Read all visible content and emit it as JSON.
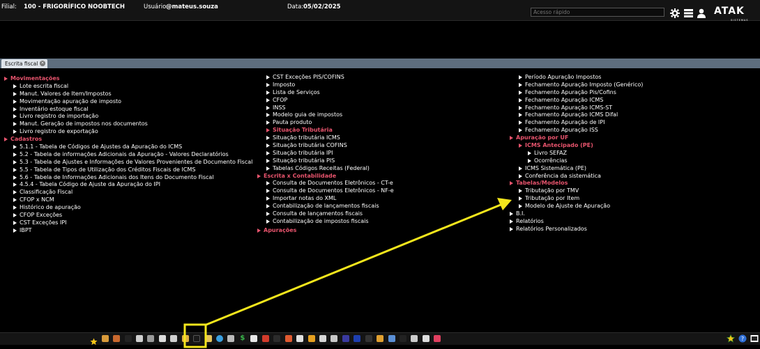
{
  "header": {
    "branch_label": "Filial:",
    "branch_value": "100 - FRIGORÍFICO NOOBTECH",
    "user_label": "Usuário:",
    "user_value": "@mateus.souza",
    "date_label": "Data:",
    "date_value": "05/02/2025",
    "quick_access_placeholder": "Acesso rápido",
    "logo_text": "ATAK",
    "logo_subtext": "SISTEMAS"
  },
  "tab": {
    "label": "Escrita fiscal"
  },
  "columns": [
    [
      {
        "type": "section",
        "label": "Movimentações",
        "level": 0
      },
      {
        "type": "item",
        "label": "Lote escrita fiscal",
        "level": 1
      },
      {
        "type": "item",
        "label": "Manut. Valores de Item/Impostos",
        "level": 1
      },
      {
        "type": "item",
        "label": "Movimentação apuração de imposto",
        "level": 1
      },
      {
        "type": "item",
        "label": "Inventário estoque fiscal",
        "level": 1
      },
      {
        "type": "item",
        "label": "Livro registro de importação",
        "level": 1
      },
      {
        "type": "item",
        "label": "Manut. Geração de impostos nos documentos",
        "level": 1
      },
      {
        "type": "item",
        "label": "Livro registro de exportação",
        "level": 1
      },
      {
        "type": "section",
        "label": "Cadastros",
        "level": 0
      },
      {
        "type": "item",
        "label": "5.1.1 - Tabela de Códigos de Ajustes da Apuração do ICMS",
        "level": 1
      },
      {
        "type": "item",
        "label": "5.2 - Tabela de informações Adicionais da Apuração - Valores Declaratórios",
        "level": 1
      },
      {
        "type": "item",
        "label": "5.3 - Tabela de Ajustes e Informações de Valores Provenientes de Documento Fiscal",
        "level": 1
      },
      {
        "type": "item",
        "label": "5.5 - Tabela de Tipos de Utilização dos Créditos Fiscais de ICMS",
        "level": 1
      },
      {
        "type": "item",
        "label": "5.6 - Tabela de Informações Adicionais dos Itens do Documento Fiscal",
        "level": 1
      },
      {
        "type": "item",
        "label": "4.5.4 - Tabela Código de Ajuste da Apuração do IPI",
        "level": 1
      },
      {
        "type": "item",
        "label": "Classificação Fiscal",
        "level": 1
      },
      {
        "type": "item",
        "label": "CFOP x NCM",
        "level": 1
      },
      {
        "type": "item",
        "label": "Histórico de apuração",
        "level": 1
      },
      {
        "type": "item",
        "label": "CFOP Exceções",
        "level": 1
      },
      {
        "type": "item",
        "label": "CST Exceções IPI",
        "level": 1
      },
      {
        "type": "item",
        "label": "IBPT",
        "level": 1
      }
    ],
    [
      {
        "type": "item",
        "label": "CST Exceções PIS/COFINS",
        "level": 0
      },
      {
        "type": "item",
        "label": "Imposto",
        "level": 0
      },
      {
        "type": "item",
        "label": "Lista de Serviços",
        "level": 0
      },
      {
        "type": "item",
        "label": "CFOP",
        "level": 0
      },
      {
        "type": "item",
        "label": "INSS",
        "level": 0
      },
      {
        "type": "item",
        "label": "Modelo guia de impostos",
        "level": 0
      },
      {
        "type": "item",
        "label": "Pauta produto",
        "level": 0
      },
      {
        "type": "section",
        "label": "Situação Tributária",
        "level": 0
      },
      {
        "type": "item",
        "label": "Situação tributária ICMS",
        "level": 1
      },
      {
        "type": "item",
        "label": "Situação tributária COFINS",
        "level": 1
      },
      {
        "type": "item",
        "label": "Situação tributária IPI",
        "level": 1
      },
      {
        "type": "item",
        "label": "Situação tributária PIS",
        "level": 1
      },
      {
        "type": "item",
        "label": "Tabelas Códigos Receitas (Federal)",
        "level": 0
      },
      {
        "type": "section",
        "label": "Escrita x Contabilidade",
        "level": -1
      },
      {
        "type": "item",
        "label": "Consulta de Documentos Eletrônicos - CT-e",
        "level": 0
      },
      {
        "type": "item",
        "label": "Consulta de Documentos Eletrônicos - NF-e",
        "level": 0
      },
      {
        "type": "item",
        "label": "Importar notas do XML",
        "level": 0
      },
      {
        "type": "item",
        "label": "Contabilização de lançamentos fiscais",
        "level": 0
      },
      {
        "type": "item",
        "label": "Consulta de lançamentos fiscais",
        "level": 0
      },
      {
        "type": "item",
        "label": "Contabilização de impostos fiscais",
        "level": 0
      },
      {
        "type": "gap"
      },
      {
        "type": "section",
        "label": "Apurações",
        "level": -1
      }
    ],
    [
      {
        "type": "item",
        "label": "Período Apuração Impostos",
        "level": 1
      },
      {
        "type": "item",
        "label": "Fechamento Apuração Imposto (Genérico)",
        "level": 1
      },
      {
        "type": "item",
        "label": "Fechamento Apuração Pis/Cofins",
        "level": 1
      },
      {
        "type": "item",
        "label": "Fechamento Apuração ICMS",
        "level": 1
      },
      {
        "type": "item",
        "label": "Fechamento Apuração ICMS-ST",
        "level": 1
      },
      {
        "type": "item",
        "label": "Fechamento Apuração ICMS Difal",
        "level": 1
      },
      {
        "type": "item",
        "label": "Fechamento Apuração de IPI",
        "level": 1
      },
      {
        "type": "item",
        "label": "Fechamento Apuração ISS",
        "level": 1
      },
      {
        "type": "section",
        "label": "Apuração por UF",
        "level": 0
      },
      {
        "type": "section",
        "label": "ICMS Antecipado (PE)",
        "level": 1
      },
      {
        "type": "item",
        "label": "Livro SEFAZ",
        "level": 2
      },
      {
        "type": "item",
        "label": "Ocorrências",
        "level": 2
      },
      {
        "type": "item",
        "label": "ICMS Sistemática (PE)",
        "level": 1
      },
      {
        "type": "item",
        "label": "Conferência da sistemática",
        "level": 1
      },
      {
        "type": "section",
        "label": "Tabelas/Modelos",
        "level": 0
      },
      {
        "type": "item",
        "label": "Tributação por TMV",
        "level": 1
      },
      {
        "type": "item",
        "label": "Tributação por Item",
        "level": 1
      },
      {
        "type": "item",
        "label": "Modelo de Ajuste de Apuração",
        "level": 1
      },
      {
        "type": "item",
        "label": "B.I.",
        "level": 0
      },
      {
        "type": "item",
        "label": "Relatórios",
        "level": 0
      },
      {
        "type": "item",
        "label": "Relatórios Personalizados",
        "level": 0
      }
    ]
  ],
  "toolbar_icons": [
    {
      "name": "favorites-star-icon",
      "color": "#f5c518"
    },
    {
      "name": "users-icon",
      "color": "#d89a3a"
    },
    {
      "name": "box-icon",
      "color": "#c9682e"
    },
    {
      "name": "dark-window-icon",
      "color": "#222222"
    },
    {
      "name": "document-icon",
      "color": "#cfcfcf"
    },
    {
      "name": "building-icon",
      "color": "#9a9a9a"
    },
    {
      "name": "truck-icon",
      "color": "#dddddd"
    },
    {
      "name": "pill-icon",
      "color": "#d0d0d0"
    },
    {
      "name": "folder-icon",
      "color": "#e0b040"
    },
    {
      "name": "fiscal-screen-icon",
      "color": "#1a1a1a"
    },
    {
      "name": "folder-yellow-icon",
      "color": "#e6c35a"
    },
    {
      "name": "globe-icon",
      "color": "#3aa0e0"
    },
    {
      "name": "cylinder-icon",
      "color": "#bbbbbb"
    },
    {
      "name": "dollar-icon",
      "color": "#39b54a"
    },
    {
      "name": "printer-icon",
      "color": "#e8e8e8"
    },
    {
      "name": "factory-icon",
      "color": "#d23b2b"
    },
    {
      "name": "calculator-icon",
      "color": "#2b2b2b"
    },
    {
      "name": "bottle-icon",
      "color": "#e05a30"
    },
    {
      "name": "card-icon",
      "color": "#e0e0e0"
    },
    {
      "name": "chart-icon",
      "color": "#e6a020"
    },
    {
      "name": "doc-edit-icon",
      "color": "#d6d6d6"
    },
    {
      "name": "notes-icon",
      "color": "#c8c8c8"
    },
    {
      "name": "book-icon",
      "color": "#3a3aa0"
    },
    {
      "name": "monitor-icon",
      "color": "#1e3fb0"
    },
    {
      "name": "tools-icon",
      "color": "#333333"
    },
    {
      "name": "package-icon",
      "color": "#e0a030"
    },
    {
      "name": "image-icon",
      "color": "#5a8fd6"
    },
    {
      "name": "terminal-icon",
      "color": "#222222"
    },
    {
      "name": "network-icon",
      "color": "#cccccc"
    },
    {
      "name": "headset-icon",
      "color": "#dddddd"
    },
    {
      "name": "analytics-icon",
      "color": "#e04060"
    }
  ],
  "annotation": {
    "highlight_color": "#f4e61c"
  }
}
